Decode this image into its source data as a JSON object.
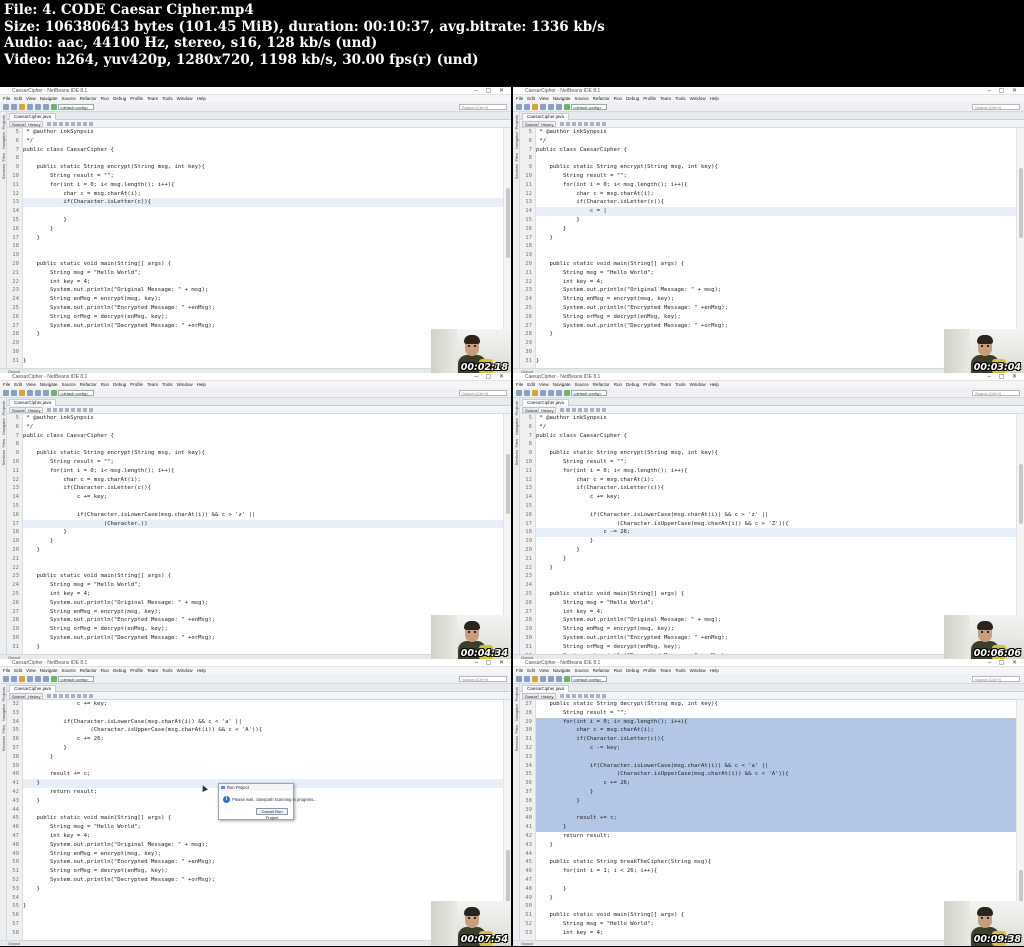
{
  "meta": {
    "file": "File: 4. CODE  Caesar Cipher.mp4",
    "size": "Size: 106380643 bytes (101.45 MiB), duration: 00:10:37, avg.bitrate: 1336 kb/s",
    "audio": "Audio: aac, 44100 Hz, stereo, s16, 128 kb/s (und)",
    "video": "Video: h264, yuv420p, 1280x720, 1198 kb/s, 30.00 fps(r) (und)"
  },
  "ide": {
    "window_title": "CaesarCipher - NetBeans IDE 8.1",
    "menu": [
      "File",
      "Edit",
      "View",
      "Navigate",
      "Source",
      "Refactor",
      "Run",
      "Debug",
      "Profile",
      "Team",
      "Tools",
      "Window",
      "Help"
    ],
    "config": "<default config>",
    "search_placeholder": "Search (Ctrl+I)",
    "file_tab": "CaesarCipher.java",
    "source_tab": "Source",
    "history_tab": "History",
    "sidebar_labels": [
      "Projects",
      "Navigator",
      "Files",
      "Services"
    ],
    "status": "Output"
  },
  "frames": [
    {
      "timestamp": "00:02:18",
      "lines": [
        {
          "n": "5",
          "t": " * @author inkSynpsis"
        },
        {
          "n": "6",
          "t": " */"
        },
        {
          "n": "7",
          "t": "public class CaesarCipher {"
        },
        {
          "n": "8",
          "t": ""
        },
        {
          "n": "9",
          "t": "    public static String encrypt(String msg, int key){"
        },
        {
          "n": "10",
          "t": "        String result = \"\";"
        },
        {
          "n": "11",
          "t": "        for(int i = 0; i< msg.length(); i++){"
        },
        {
          "n": "12",
          "t": "            char c = msg.charAt(i);"
        },
        {
          "n": "13",
          "t": "            if(Character.isLetter(c)){",
          "hl": true
        },
        {
          "n": "14",
          "t": ""
        },
        {
          "n": "15",
          "t": "            }"
        },
        {
          "n": "16",
          "t": "        }"
        },
        {
          "n": "17",
          "t": "    }"
        },
        {
          "n": "18",
          "t": ""
        },
        {
          "n": "19",
          "t": ""
        },
        {
          "n": "20",
          "t": "    public static void main(String[] args) {"
        },
        {
          "n": "21",
          "t": "        String msg = \"Hello World\";"
        },
        {
          "n": "22",
          "t": "        int key = 4;"
        },
        {
          "n": "23",
          "t": "        System.out.println(\"Original Message: \" + msg);"
        },
        {
          "n": "24",
          "t": "        String enMsg = encrypt(msg, key);"
        },
        {
          "n": "25",
          "t": "        System.out.println(\"Encrypted Message: \" +enMsg);"
        },
        {
          "n": "26",
          "t": "        String orMsg = decrypt(enMsg, key);"
        },
        {
          "n": "27",
          "t": "        System.out.println(\"Decrypted Message: \" +orMsg);"
        },
        {
          "n": "28",
          "t": "    }"
        },
        {
          "n": "29",
          "t": ""
        },
        {
          "n": "30",
          "t": ""
        },
        {
          "n": "31",
          "t": "}"
        }
      ]
    },
    {
      "timestamp": "00:03:04",
      "lines": [
        {
          "n": "5",
          "t": " * @author inkSynpsis"
        },
        {
          "n": "6",
          "t": " */"
        },
        {
          "n": "7",
          "t": "public class CaesarCipher {"
        },
        {
          "n": "8",
          "t": ""
        },
        {
          "n": "9",
          "t": "    public static String encrypt(String msg, int key){"
        },
        {
          "n": "10",
          "t": "        String result = \"\";"
        },
        {
          "n": "11",
          "t": "        for(int i = 0; i< msg.length(); i++){"
        },
        {
          "n": "12",
          "t": "            char c = msg.charAt(i);"
        },
        {
          "n": "13",
          "t": "            if(Character.isLetter(c)){"
        },
        {
          "n": "14",
          "t": "                c = |",
          "hl": true
        },
        {
          "n": "15",
          "t": "            }"
        },
        {
          "n": "16",
          "t": "        }"
        },
        {
          "n": "17",
          "t": "    }"
        },
        {
          "n": "18",
          "t": ""
        },
        {
          "n": "19",
          "t": ""
        },
        {
          "n": "20",
          "t": "    public static void main(String[] args) {"
        },
        {
          "n": "21",
          "t": "        String msg = \"Hello World\";"
        },
        {
          "n": "22",
          "t": "        int key = 4;"
        },
        {
          "n": "23",
          "t": "        System.out.println(\"Original Message: \" + msg);"
        },
        {
          "n": "24",
          "t": "        String enMsg = encrypt(msg, key);"
        },
        {
          "n": "25",
          "t": "        System.out.println(\"Encrypted Message: \" +enMsg);"
        },
        {
          "n": "26",
          "t": "        String orMsg = decrypt(enMsg, key);"
        },
        {
          "n": "27",
          "t": "        System.out.println(\"Decrypted Message: \" +orMsg);"
        },
        {
          "n": "28",
          "t": "    }"
        },
        {
          "n": "29",
          "t": ""
        },
        {
          "n": "30",
          "t": ""
        },
        {
          "n": "31",
          "t": "}"
        }
      ]
    },
    {
      "timestamp": "00:04:34",
      "lines": [
        {
          "n": "5",
          "t": " * @author inkSynpsis"
        },
        {
          "n": "6",
          "t": " */"
        },
        {
          "n": "7",
          "t": "public class CaesarCipher {"
        },
        {
          "n": "8",
          "t": ""
        },
        {
          "n": "9",
          "t": "    public static String encrypt(String msg, int key){"
        },
        {
          "n": "10",
          "t": "        String result = \"\";"
        },
        {
          "n": "11",
          "t": "        for(int i = 0; i< msg.length(); i++){"
        },
        {
          "n": "12",
          "t": "            char c = msg.charAt(i);"
        },
        {
          "n": "13",
          "t": "            if(Character.isLetter(c)){"
        },
        {
          "n": "14",
          "t": "                c += key;"
        },
        {
          "n": "15",
          "t": ""
        },
        {
          "n": "16",
          "t": "                if(Character.isLowerCase(msg.charAt(i)) && c > 'z' ||"
        },
        {
          "n": "17",
          "t": "                        (Character.))",
          "hl": true
        },
        {
          "n": "18",
          "t": "            }"
        },
        {
          "n": "19",
          "t": "        }"
        },
        {
          "n": "20",
          "t": "    }"
        },
        {
          "n": "21",
          "t": ""
        },
        {
          "n": "22",
          "t": ""
        },
        {
          "n": "23",
          "t": "    public static void main(String[] args) {"
        },
        {
          "n": "24",
          "t": "        String msg = \"Hello World\";"
        },
        {
          "n": "25",
          "t": "        int key = 4;"
        },
        {
          "n": "26",
          "t": "        System.out.println(\"Original Message: \" + msg);"
        },
        {
          "n": "27",
          "t": "        String enMsg = encrypt(msg, key);"
        },
        {
          "n": "28",
          "t": "        System.out.println(\"Encrypted Message: \" +enMsg);"
        },
        {
          "n": "29",
          "t": "        String orMsg = decrypt(enMsg, key);"
        },
        {
          "n": "30",
          "t": "        System.out.println(\"Decrypted Message: \" +orMsg);"
        },
        {
          "n": "31",
          "t": "    }"
        }
      ]
    },
    {
      "timestamp": "00:06:06",
      "lines": [
        {
          "n": "5",
          "t": " * @author inkSynpsis"
        },
        {
          "n": "6",
          "t": " */"
        },
        {
          "n": "7",
          "t": "public class CaesarCipher {"
        },
        {
          "n": "8",
          "t": ""
        },
        {
          "n": "9",
          "t": "    public static String encrypt(String msg, int key){"
        },
        {
          "n": "10",
          "t": "        String result = \"\";"
        },
        {
          "n": "11",
          "t": "        for(int i = 0; i< msg.length(); i++){"
        },
        {
          "n": "12",
          "t": "            char c = msg.charAt(i);"
        },
        {
          "n": "13",
          "t": "            if(Character.isLetter(c)){"
        },
        {
          "n": "14",
          "t": "                c += key;"
        },
        {
          "n": "15",
          "t": ""
        },
        {
          "n": "16",
          "t": "                if(Character.isLowerCase(msg.charAt(i)) && c > 'z' ||"
        },
        {
          "n": "17",
          "t": "                        (Character.isUpperCase(msg.charAt(i)) && c > 'Z')){"
        },
        {
          "n": "18",
          "t": "                    c -= 26;",
          "hl": true
        },
        {
          "n": "19",
          "t": "                }"
        },
        {
          "n": "20",
          "t": "            }"
        },
        {
          "n": "21",
          "t": "        }"
        },
        {
          "n": "22",
          "t": "    }"
        },
        {
          "n": "23",
          "t": ""
        },
        {
          "n": "24",
          "t": ""
        },
        {
          "n": "25",
          "t": "    public static void main(String[] args) {"
        },
        {
          "n": "26",
          "t": "        String msg = \"Hello World\";"
        },
        {
          "n": "27",
          "t": "        int key = 4;"
        },
        {
          "n": "28",
          "t": "        System.out.println(\"Original Message: \" + msg);"
        },
        {
          "n": "29",
          "t": "        String enMsg = encrypt(msg, key);"
        },
        {
          "n": "30",
          "t": "        System.out.println(\"Encrypted Message: \" +enMsg);"
        },
        {
          "n": "31",
          "t": "        String orMsg = decrypt(enMsg, key);"
        },
        {
          "n": "32",
          "t": "        System.out.println(\"Decrypted Message: \" +orMsg);"
        }
      ]
    },
    {
      "timestamp": "00:07:54",
      "lines": [
        {
          "n": "32",
          "t": "                c += key;"
        },
        {
          "n": "33",
          "t": ""
        },
        {
          "n": "34",
          "t": "            if(Character.isLowerCase(msg.charAt(i)) && c < 'a' ||"
        },
        {
          "n": "35",
          "t": "                    (Character.isUpperCase(msg.charAt(i)) && c < 'A')){"
        },
        {
          "n": "36",
          "t": "                c += 26;"
        },
        {
          "n": "37",
          "t": "            }"
        },
        {
          "n": "38",
          "t": "        }"
        },
        {
          "n": "39",
          "t": ""
        },
        {
          "n": "40",
          "t": "        result += c;"
        },
        {
          "n": "41",
          "t": "    }",
          "hl": true
        },
        {
          "n": "42",
          "t": "        return result;"
        },
        {
          "n": "43",
          "t": "    }"
        },
        {
          "n": "44",
          "t": ""
        },
        {
          "n": "45",
          "t": "    public static void main(String[] args) {"
        },
        {
          "n": "46",
          "t": "        String msg = \"Hello World\";"
        },
        {
          "n": "47",
          "t": "        int key = 4;"
        },
        {
          "n": "48",
          "t": "        System.out.println(\"Original Message: \" + msg);"
        },
        {
          "n": "49",
          "t": "        String enMsg = encrypt(msg, key);"
        },
        {
          "n": "50",
          "t": "        System.out.println(\"Encrypted Message: \" +enMsg);"
        },
        {
          "n": "51",
          "t": "        String orMsg = decrypt(enMsg, key);"
        },
        {
          "n": "52",
          "t": "        System.out.println(\"Decrypted Message: \" +orMsg);"
        },
        {
          "n": "53",
          "t": "    }"
        },
        {
          "n": "54",
          "t": ""
        },
        {
          "n": "55",
          "t": "}"
        },
        {
          "n": "56",
          "t": ""
        },
        {
          "n": "57",
          "t": ""
        },
        {
          "n": "58",
          "t": ""
        }
      ]
    },
    {
      "timestamp": "00:09:38",
      "lines": [
        {
          "n": "27",
          "t": "    public static String decrypt(String msg, int key){"
        },
        {
          "n": "28",
          "t": "        String result = \"\";"
        },
        {
          "n": "29",
          "t": "        for(int i = 0; i< msg.length(); i++){",
          "sel": true
        },
        {
          "n": "30",
          "t": "            char c = msg.charAt(i);",
          "sel": true
        },
        {
          "n": "31",
          "t": "            if(Character.isLetter(c)){",
          "sel": true
        },
        {
          "n": "32",
          "t": "                c -= key;",
          "sel": true
        },
        {
          "n": "33",
          "t": "",
          "sel": true
        },
        {
          "n": "34",
          "t": "                if(Character.isLowerCase(msg.charAt(i)) && c < 'a' ||",
          "sel": true
        },
        {
          "n": "35",
          "t": "                        (Character.isUpperCase(msg.charAt(i)) && c < 'A')){",
          "sel": true
        },
        {
          "n": "36",
          "t": "                    c += 26;",
          "sel": true
        },
        {
          "n": "37",
          "t": "                }",
          "sel": true
        },
        {
          "n": "38",
          "t": "            }",
          "sel": true
        },
        {
          "n": "39",
          "t": "",
          "sel": true
        },
        {
          "n": "40",
          "t": "            result += c;",
          "sel": true
        },
        {
          "n": "41",
          "t": "        }",
          "sel": true
        },
        {
          "n": "42",
          "t": "        return result;"
        },
        {
          "n": "43",
          "t": "    }"
        },
        {
          "n": "44",
          "t": ""
        },
        {
          "n": "45",
          "t": "    public static String breakTheCipher(String msg){"
        },
        {
          "n": "46",
          "t": "        for(int i = 1; i < 26; i++){"
        },
        {
          "n": "47",
          "t": ""
        },
        {
          "n": "48",
          "t": "        }"
        },
        {
          "n": "49",
          "t": "    }"
        },
        {
          "n": "50",
          "t": ""
        },
        {
          "n": "51",
          "t": "    public static void main(String[] args) {"
        },
        {
          "n": "52",
          "t": "        String msg = \"Hello World\";"
        },
        {
          "n": "53",
          "t": "        int key = 4;"
        }
      ]
    }
  ],
  "dialog": {
    "title": "Run Project",
    "message": "Please wait, classpath scanning in progress...",
    "button": "Cancel Run Project"
  }
}
